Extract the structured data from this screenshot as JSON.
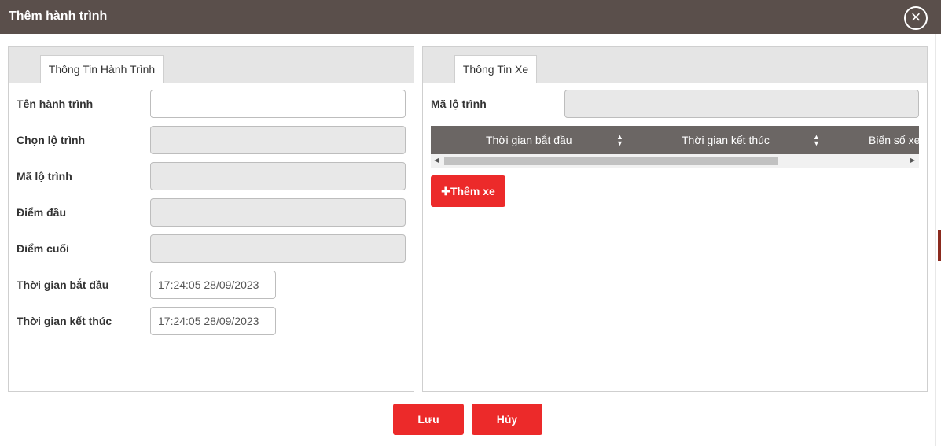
{
  "header": {
    "title": "Thêm hành trình",
    "close_icon": "close-icon"
  },
  "left_panel": {
    "tab_label": "Thông Tin Hành Trình",
    "fields": [
      {
        "label": "Tên hành trình",
        "value": ""
      },
      {
        "label": "Chọn lộ trình",
        "value": ""
      },
      {
        "label": "Mã lộ trình",
        "value": ""
      },
      {
        "label": "Điểm đầu",
        "value": ""
      },
      {
        "label": "Điểm cuối",
        "value": ""
      },
      {
        "label": "Thời gian bắt đầu",
        "value": "17:24:05 28/09/2023"
      },
      {
        "label": "Thời gian kết thúc",
        "value": "17:24:05 28/09/2023"
      }
    ]
  },
  "right_panel": {
    "tab_label": "Thông Tin Xe",
    "route_code_label": "Mã lộ trình",
    "route_code_value": "",
    "table_headers": [
      "Thời gian bắt đầu",
      "Thời gian kết thúc",
      "Biển số xe"
    ],
    "add_button_label": "Thêm xe"
  },
  "footer": {
    "save_label": "Lưu",
    "cancel_label": "Hủy"
  },
  "colors": {
    "header_bg": "#5a4f4b",
    "accent": "#ec2a2a",
    "table_header_bg": "#6b6664"
  }
}
